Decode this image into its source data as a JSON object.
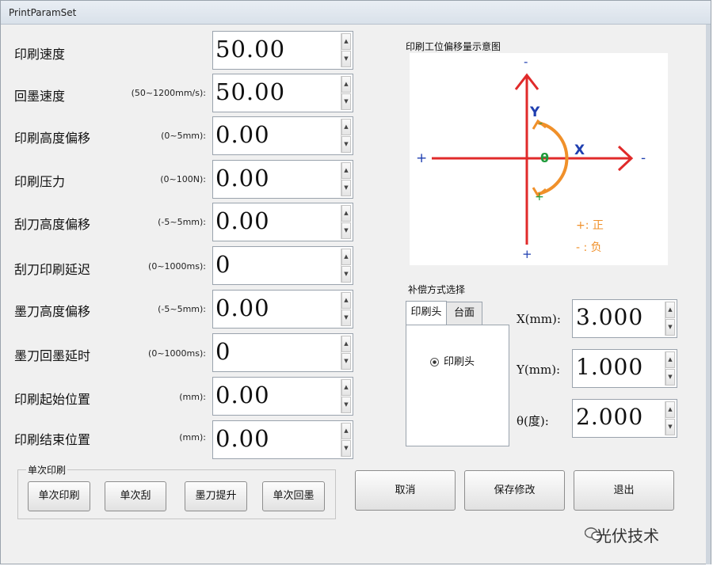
{
  "window": {
    "title": "PrintParamSet"
  },
  "params": [
    {
      "label": "印刷速度",
      "range": "",
      "value": "50.00"
    },
    {
      "label": "回墨速度",
      "range": "(50~1200mm/s):",
      "value": "50.00"
    },
    {
      "label": "印刷高度偏移",
      "range": "(0~5mm):",
      "value": "0.00"
    },
    {
      "label": "印刷压力",
      "range": "(0~100N):",
      "value": "0.00"
    },
    {
      "label": "刮刀高度偏移",
      "range": "(-5~5mm):",
      "value": "0.00"
    },
    {
      "label": "刮刀印刷延迟",
      "range": "(0~1000ms):",
      "value": "0"
    },
    {
      "label": "墨刀高度偏移",
      "range": "(-5~5mm):",
      "value": "0.00"
    },
    {
      "label": "墨刀回墨延时",
      "range": "(0~1000ms):",
      "value": "0"
    },
    {
      "label": "印刷起始位置",
      "range": "(mm):",
      "value": "0.00"
    },
    {
      "label": "印刷结束位置",
      "range": "(mm):",
      "value": "0.00"
    }
  ],
  "diagram": {
    "title": "印刷工位偏移量示意图",
    "y_label": "Y",
    "x_label": "X",
    "theta_label": "θ",
    "plus": "+",
    "minus": "-",
    "legend_positive": "+: 正",
    "legend_negative": "- : 负",
    "colors": {
      "axis": "#e02a2a",
      "xy_label": "#1f3fb0",
      "arc": "#f0902a",
      "theta": "#1f9a3a",
      "legend": "#f0902a",
      "signs": "#1f3fb0",
      "plus_green": "#1f9a3a"
    }
  },
  "compensation": {
    "group_label": "补偿方式选择",
    "tabs": [
      "印刷头",
      "台面"
    ],
    "radio_label": "印刷头",
    "fields": [
      {
        "label": "X(mm):",
        "value": "3.000"
      },
      {
        "label": "Y(mm):",
        "value": "1.000"
      },
      {
        "label": "θ(度):",
        "value": "2.000"
      }
    ]
  },
  "single_print": {
    "group_label": "单次印刷",
    "buttons": [
      "单次印刷",
      "单次刮",
      "墨刀提升",
      "单次回墨"
    ]
  },
  "actions": {
    "cancel": "取消",
    "save": "保存修改",
    "exit": "退出"
  },
  "watermark": "光伏技术",
  "spin_up_icon": "▲",
  "spin_down_icon": "▼"
}
